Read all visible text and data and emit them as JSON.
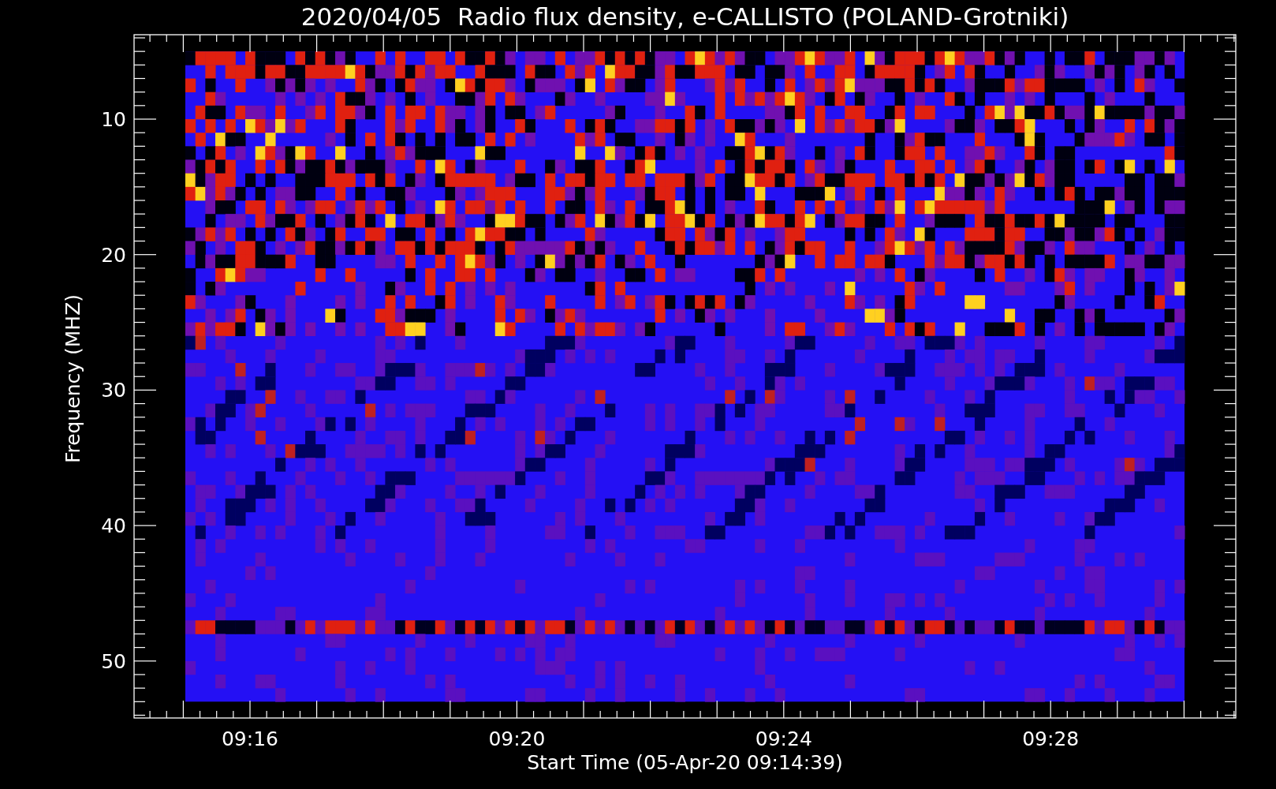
{
  "title": "2020/04/05  Radio flux density, e-CALLISTO (POLAND-Grotniki)",
  "y_axis": {
    "label": "Frequency (MHZ)",
    "ticks": [
      "10",
      "20",
      "30",
      "40",
      "50"
    ]
  },
  "x_axis": {
    "label": "Start Time (05-Apr-20 09:14:39)",
    "ticks": [
      "09:16",
      "09:20",
      "09:24",
      "09:28"
    ]
  }
}
